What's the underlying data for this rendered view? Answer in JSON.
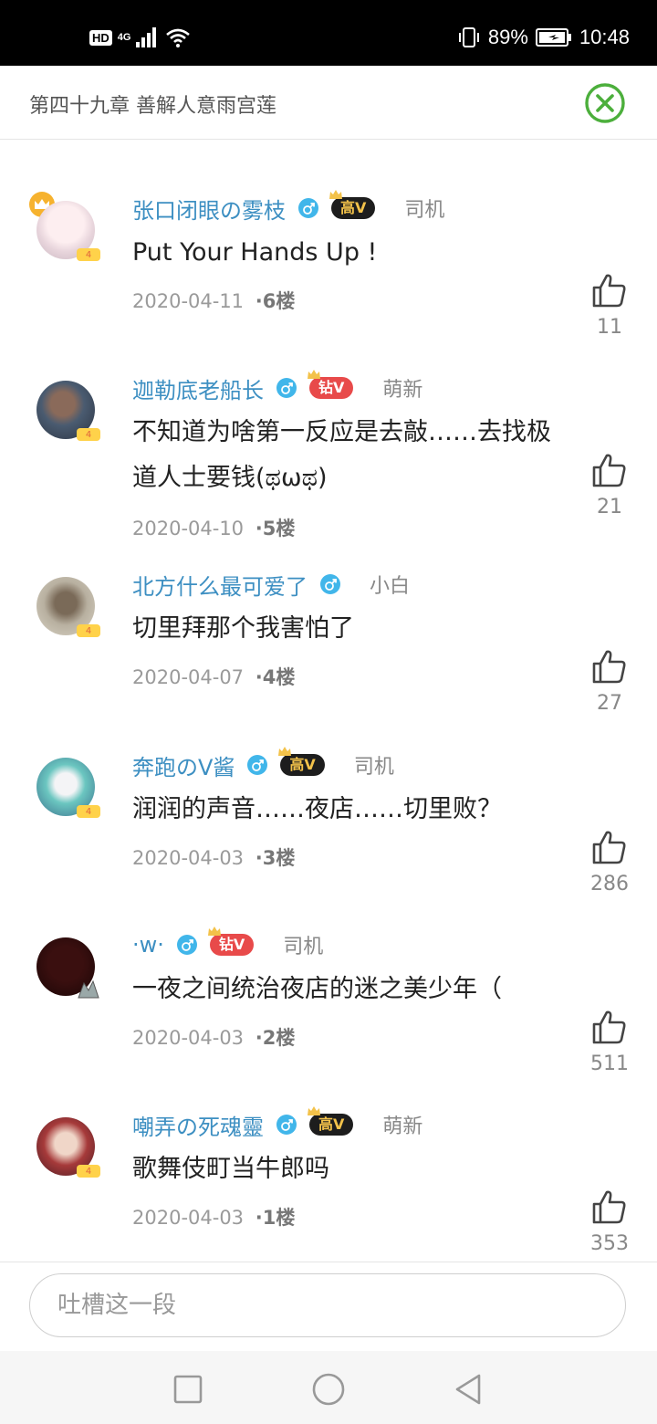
{
  "status_bar": {
    "hd": "HD",
    "network": "4G",
    "battery_percent": "89%",
    "time": "10:48"
  },
  "header": {
    "chapter_title": "第四十九章 善解人意雨宫莲",
    "close_icon": "close-circle-icon",
    "accent_color": "#4caf3c"
  },
  "comments": [
    {
      "username": "张口闭眼の雾枝",
      "vip": "高V",
      "vip_type": "high",
      "role": "司机",
      "text": "Put Your Hands Up !",
      "date": "2020-04-11",
      "floor": "·6楼",
      "likes": "11",
      "crown": true
    },
    {
      "username": "迦勒底老船长",
      "vip": "钻V",
      "vip_type": "diamond",
      "role": "萌新",
      "text": "不知道为啥第一反应是去敲……去找极道人士要钱(ಥωಥ)",
      "date": "2020-04-10",
      "floor": "·5楼",
      "likes": "21",
      "crown": false
    },
    {
      "username": "北方什么最可爱了",
      "vip": "",
      "vip_type": "none",
      "role": "小白",
      "text": "切里拜那个我害怕了",
      "date": "2020-04-07",
      "floor": "·4楼",
      "likes": "27",
      "crown": false
    },
    {
      "username": "奔跑のV酱",
      "vip": "高V",
      "vip_type": "high",
      "role": "司机",
      "text": "润润的声音……夜店……切里败？",
      "date": "2020-04-03",
      "floor": "·3楼",
      "likes": "286",
      "crown": false
    },
    {
      "username": "·w·",
      "vip": "钻V",
      "vip_type": "diamond",
      "role": "司机",
      "text": "一夜之间统治夜店的迷之美少年（",
      "date": "2020-04-03",
      "floor": "·2楼",
      "likes": "511",
      "crown": false
    },
    {
      "username": "嘲弄の死魂靈",
      "vip": "高V",
      "vip_type": "high",
      "role": "萌新",
      "text": "歌舞伎町当牛郎吗",
      "date": "2020-04-03",
      "floor": "·1楼",
      "likes": "353",
      "crown": false
    }
  ],
  "input": {
    "placeholder": "吐槽这一段"
  },
  "nav": {
    "recent_icon": "square-icon",
    "home_icon": "circle-icon",
    "back_icon": "triangle-back-icon"
  }
}
